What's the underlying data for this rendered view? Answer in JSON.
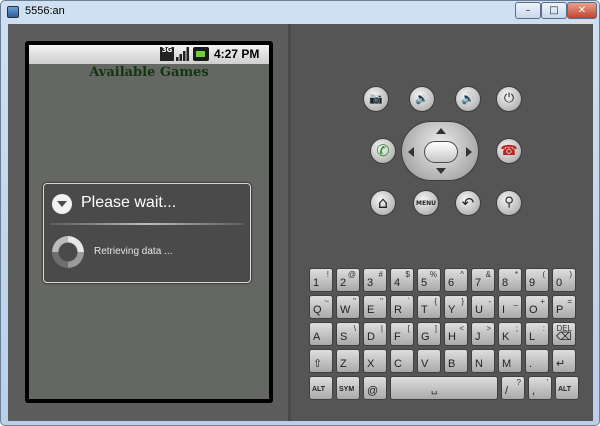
{
  "window": {
    "title": "5556:an",
    "min_glyph": "–",
    "max_glyph": "□",
    "close_glyph": "✕"
  },
  "statusbar": {
    "network": "3G",
    "time": "4:27 PM"
  },
  "app": {
    "title": "Available Games"
  },
  "dialog": {
    "title": "Please wait...",
    "message": "Retrieving data ..."
  },
  "hw_buttons": {
    "camera": "📷",
    "vol_down": "🔉",
    "vol_up": "🔊",
    "power": "⏻",
    "call": "✆",
    "end_call": "☎",
    "home": "⌂",
    "menu": "MENU",
    "back": "↶",
    "search": "⚲"
  },
  "keyboard": {
    "rows": [
      [
        {
          "main": "1",
          "alt": "!"
        },
        {
          "main": "2",
          "alt": "@"
        },
        {
          "main": "3",
          "alt": "#"
        },
        {
          "main": "4",
          "alt": "$"
        },
        {
          "main": "5",
          "alt": "%"
        },
        {
          "main": "6",
          "alt": "^"
        },
        {
          "main": "7",
          "alt": "&"
        },
        {
          "main": "8",
          "alt": "*"
        },
        {
          "main": "9",
          "alt": "("
        },
        {
          "main": "0",
          "alt": ")"
        }
      ],
      [
        {
          "main": "Q",
          "alt": "~"
        },
        {
          "main": "W",
          "alt": "\""
        },
        {
          "main": "E",
          "alt": "\""
        },
        {
          "main": "R",
          "alt": "`"
        },
        {
          "main": "T",
          "alt": "{"
        },
        {
          "main": "Y",
          "alt": "}"
        },
        {
          "main": "U",
          "alt": "-"
        },
        {
          "main": "I",
          "alt": "_"
        },
        {
          "main": "O",
          "alt": "+"
        },
        {
          "main": "P",
          "alt": "="
        }
      ],
      [
        {
          "main": "A",
          "alt": ""
        },
        {
          "main": "S",
          "alt": "\\"
        },
        {
          "main": "D",
          "alt": "|"
        },
        {
          "main": "F",
          "alt": "["
        },
        {
          "main": "G",
          "alt": "]"
        },
        {
          "main": "H",
          "alt": "<"
        },
        {
          "main": "J",
          "alt": ">"
        },
        {
          "main": "K",
          "alt": ";"
        },
        {
          "main": "L",
          "alt": ":"
        },
        {
          "main": "⌫",
          "alt": "DEL"
        }
      ],
      [
        {
          "main": "⇧",
          "alt": ""
        },
        {
          "main": "Z",
          "alt": ""
        },
        {
          "main": "X",
          "alt": ""
        },
        {
          "main": "C",
          "alt": ""
        },
        {
          "main": "V",
          "alt": ""
        },
        {
          "main": "B",
          "alt": ""
        },
        {
          "main": "N",
          "alt": ""
        },
        {
          "main": "M",
          "alt": ""
        },
        {
          "main": ".",
          "alt": ""
        },
        {
          "main": "↵",
          "alt": ""
        }
      ],
      [
        {
          "main": "ALT",
          "alt": ""
        },
        {
          "main": "SYM",
          "alt": ""
        },
        {
          "main": "@",
          "alt": ""
        },
        {
          "main": "␣",
          "alt": ""
        },
        {
          "main": "/",
          "alt": "?"
        },
        {
          "main": ",",
          "alt": "'"
        },
        {
          "main": "ALT",
          "alt": ""
        }
      ]
    ]
  },
  "colors": {
    "screen_bg": "#6e706b",
    "title_green": "#123b12",
    "emulator_bg": "#5d5d5d",
    "call_green": "#2e8b2e",
    "end_red": "#c0201c"
  }
}
